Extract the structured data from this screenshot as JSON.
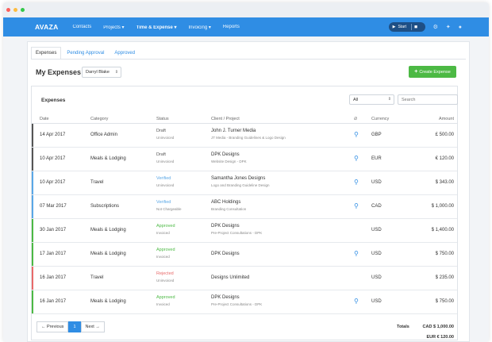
{
  "colors": {
    "brand": "#2f8de4",
    "success": "#4cb944",
    "draft": "#555555",
    "verified": "#5aa7e6",
    "approved": "#4cb944",
    "rejected": "#e86a6a",
    "dot_red": "#fc605c",
    "dot_yellow": "#fdbc40",
    "dot_green": "#34c84a"
  },
  "nav": {
    "brand": "AVAZA",
    "items": [
      "Contacts",
      "Projects ▾",
      "Time & Expense ▾",
      "Invoicing ▾",
      "Reports"
    ],
    "timer_label": "Start",
    "icons": [
      "play-icon",
      "stop-icon",
      "help-icon",
      "notification-icon",
      "user-icon"
    ]
  },
  "tabs": [
    "Expenses",
    "Pending Approval",
    "Approved"
  ],
  "page": {
    "title": "My Expenses",
    "user_select": "Darryl Blake",
    "create_button": "Create Expense"
  },
  "panel": {
    "title": "Expenses",
    "filter_value": "All",
    "search_placeholder": "Search",
    "columns": {
      "date": "Date",
      "category": "Category",
      "status": "Status",
      "client": "Client / Project",
      "currency": "Currency",
      "amount": "Amount"
    }
  },
  "rows": [
    {
      "date": "14 Apr 2017",
      "category": "Office Admin",
      "status": "Draft",
      "status_type": "draft",
      "sub": "Uninvoiced",
      "client": "John J. Turner Media",
      "project": "JT Media - Branding Guidelines & Logo Design",
      "attachment": true,
      "currency": "GBP",
      "amount": "£ 500.00"
    },
    {
      "date": "10 Apr 2017",
      "category": "Meals & Lodging",
      "status": "Draft",
      "status_type": "draft",
      "sub": "Uninvoiced",
      "client": "DPK Designs",
      "project": "Website Design - DPK",
      "attachment": true,
      "currency": "EUR",
      "amount": "€ 120.00"
    },
    {
      "date": "10 Apr 2017",
      "category": "Travel",
      "status": "Verified",
      "status_type": "verified",
      "sub": "Uninvoiced",
      "client": "Samantha Jones Designs",
      "project": "Logo and Branding Guideline Design",
      "attachment": true,
      "currency": "USD",
      "amount": "$ 343.00"
    },
    {
      "date": "07 Mar 2017",
      "category": "Subscriptions",
      "status": "Verified",
      "status_type": "verified",
      "sub": "Not Chargeable",
      "client": "ABC Holdings",
      "project": "Branding Consultation",
      "attachment": true,
      "currency": "CAD",
      "amount": "$ 1,000.00"
    },
    {
      "date": "30 Jan 2017",
      "category": "Meals & Lodging",
      "status": "Approved",
      "status_type": "approved",
      "sub": "Invoiced",
      "client": "DPK Designs",
      "project": "Pre-Project Consultations - DPK",
      "attachment": false,
      "currency": "USD",
      "amount": "$ 1,400.00"
    },
    {
      "date": "17 Jan 2017",
      "category": "Meals & Lodging",
      "status": "Approved",
      "status_type": "approved",
      "sub": "Invoiced",
      "client": "DPK Designs",
      "project": "",
      "attachment": true,
      "currency": "USD",
      "amount": "$ 750.00"
    },
    {
      "date": "16 Jan 2017",
      "category": "Travel",
      "status": "Rejected",
      "status_type": "rejected",
      "sub": "Uninvoiced",
      "client": "Designs Unlimited",
      "project": "",
      "attachment": false,
      "currency": "USD",
      "amount": "$ 235.00"
    },
    {
      "date": "16 Jan 2017",
      "category": "Meals & Lodging",
      "status": "Approved",
      "status_type": "approved",
      "sub": "Invoiced",
      "client": "DPK Designs",
      "project": "Pre-Project Consultations - DPK",
      "attachment": true,
      "currency": "USD",
      "amount": "$ 750.00"
    }
  ],
  "pager": {
    "prev": "← Previous",
    "page": "1",
    "next": "Next →"
  },
  "totals": {
    "label": "Totals",
    "line1": "CAD $ 1,000.00",
    "line2": "EUR € 120.00"
  }
}
